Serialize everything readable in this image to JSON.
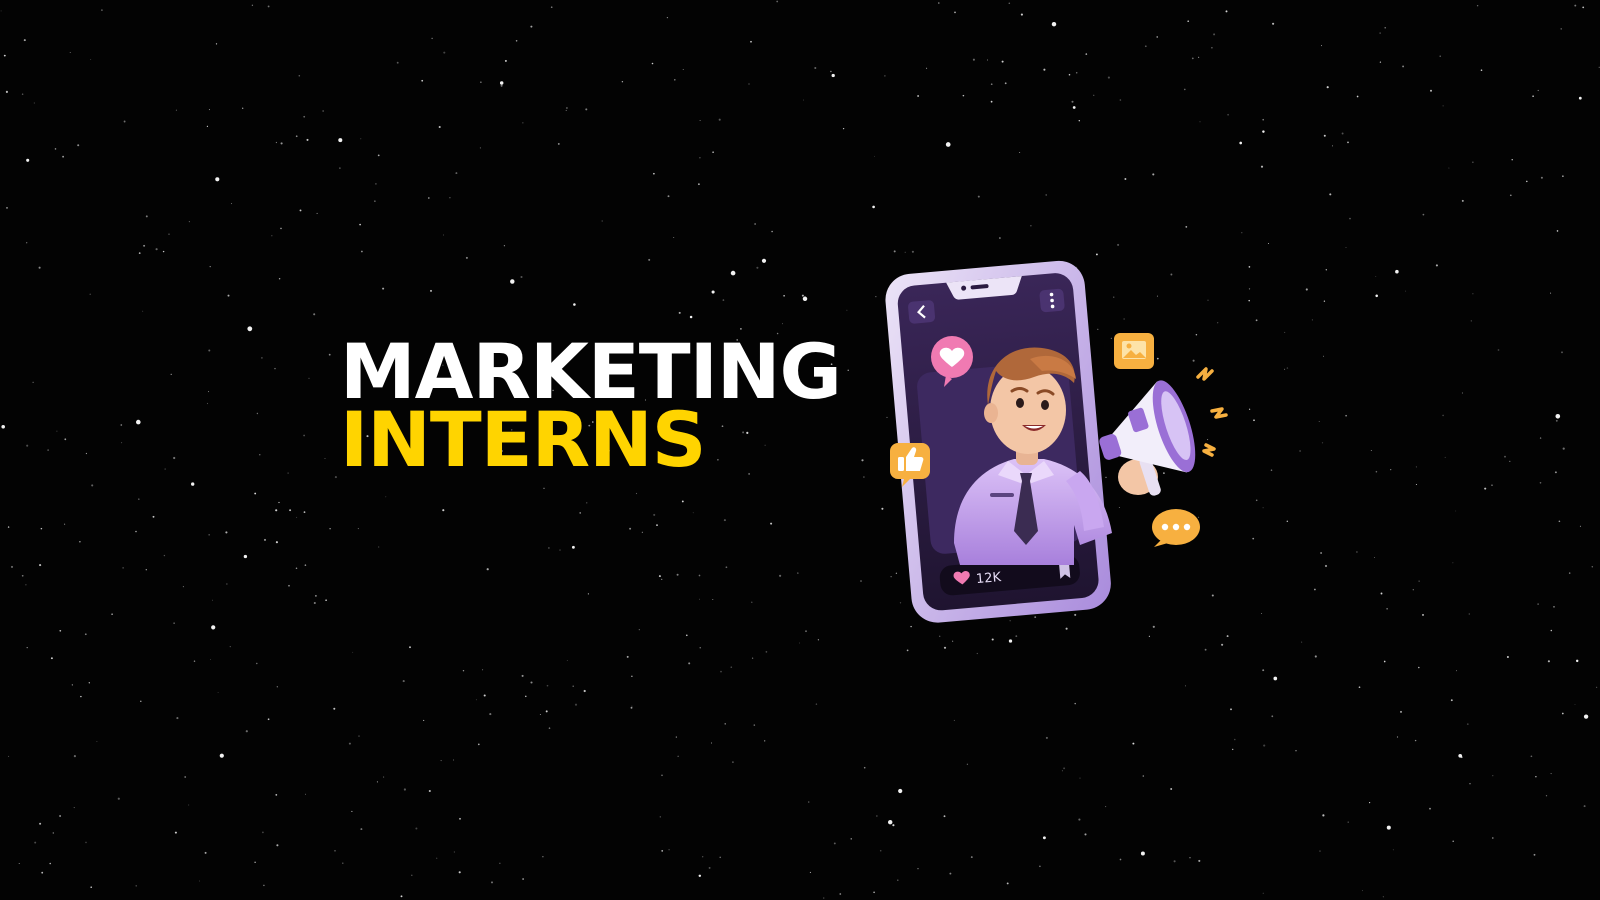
{
  "headline": {
    "line1": "MARKETING",
    "line2": "INTERNS"
  },
  "colors": {
    "background": "#030303",
    "line1": "#ffffff",
    "line2": "#ffd400",
    "phone_body": "#a98bdc",
    "phone_screen": "#2a1a40",
    "shirt": "#c9a7f0",
    "tie": "#3b2c52",
    "hair": "#b0683a",
    "skin": "#f3c6a6",
    "heart_bubble": "#f07ab2",
    "accent_orange": "#f7b040"
  },
  "phone": {
    "likes": "12K"
  },
  "icons": [
    "back-chevron-icon",
    "more-dots-icon",
    "heart-icon",
    "bookmark-icon",
    "thumbs-up-icon",
    "image-icon",
    "chat-dots-icon",
    "megaphone-icon"
  ]
}
